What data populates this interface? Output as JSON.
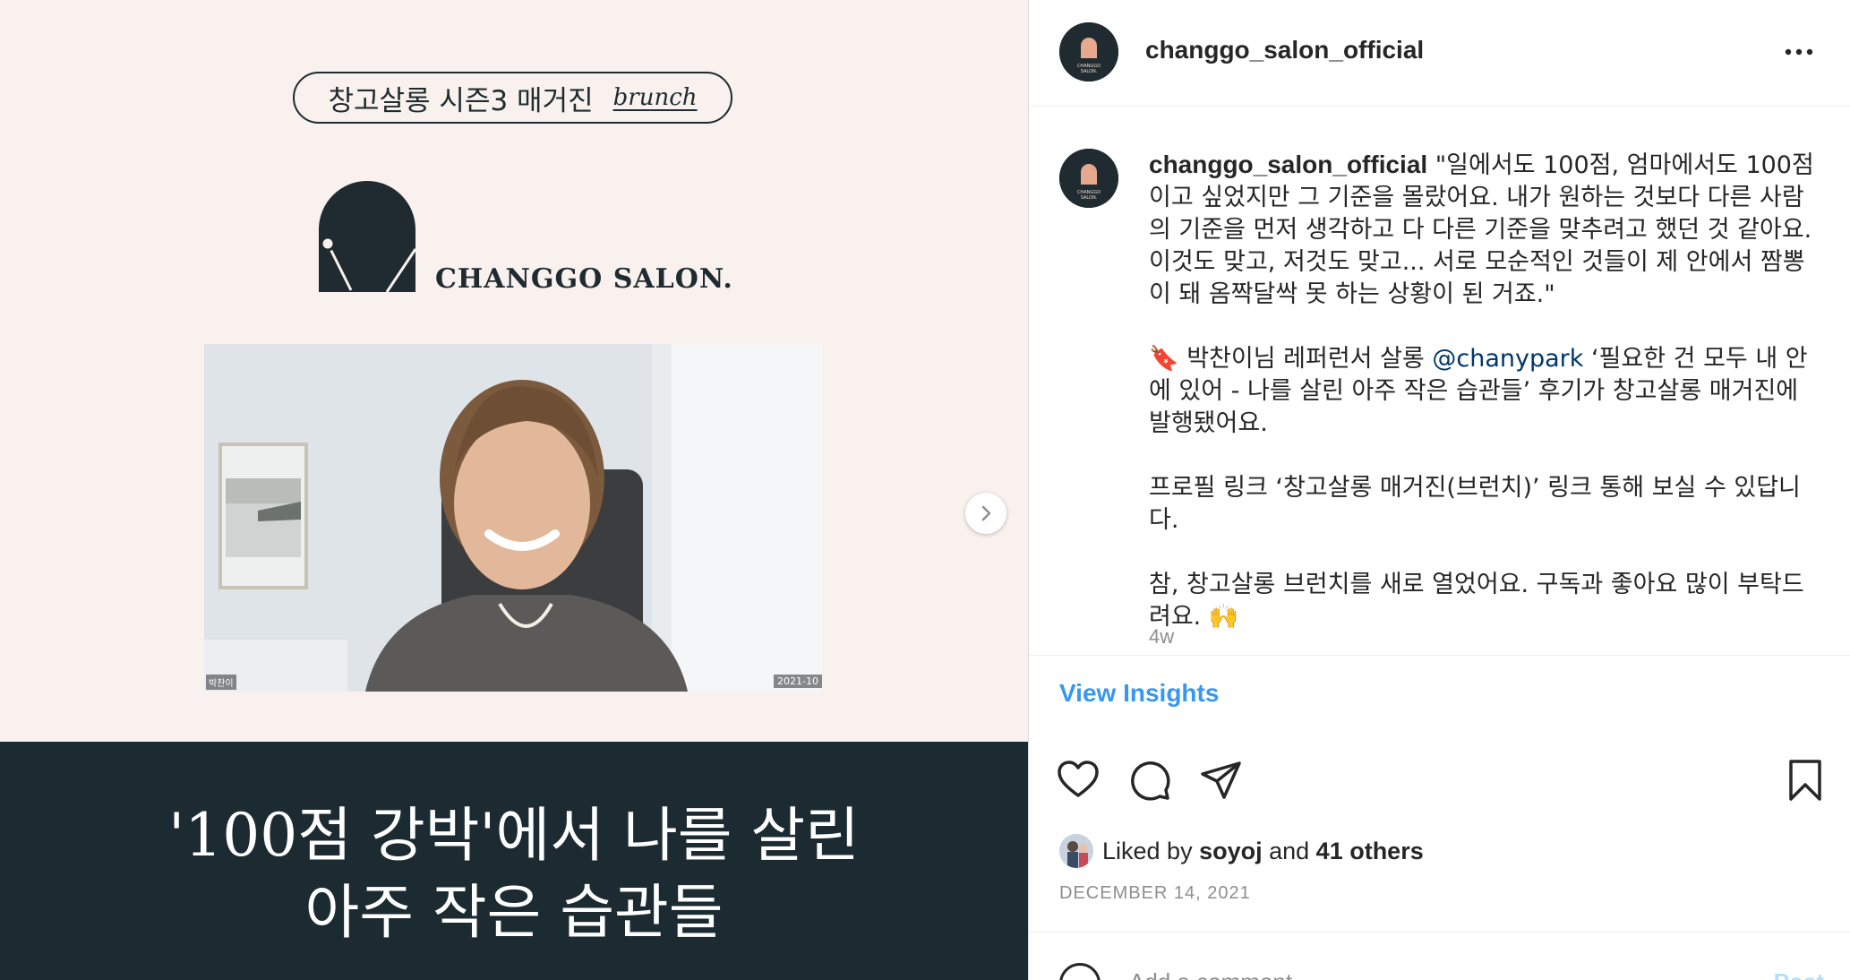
{
  "post_image": {
    "magazine_label": "창고살롱 시즌3 매거진",
    "brunch_label": "brunch",
    "logo_text": "CHANGGO SALON.",
    "video_name_tag": "박찬이",
    "video_date_tag": "2021-10",
    "headline_line1": "'100점 강박'에서 나를 살린",
    "headline_line2": "아주 작은 습관들",
    "next_arrow_icon": "chevron-right-icon"
  },
  "header": {
    "username": "changgo_salon_official",
    "more_icon": "more-horizontal-icon"
  },
  "caption": {
    "username": "changgo_salon_official",
    "paragraph1": "\"일에서도 100점, 엄마에서도 100점이고 싶었지만 그 기준을 몰랐어요. 내가 원하는 것보다 다른 사람의 기준을 먼저 생각하고 다 다른 기준을 맞추려고 했던 것 같아요. 이것도 맞고, 저것도 맞고... 서로 모순적인 것들이 제 안에서 짬뽕이 돼 옴짝달싹 못 하는 상황이 된 거죠.\"",
    "p2_emoji": "🔖",
    "p2_pre": " 박찬이님 레퍼런서 살롱 ",
    "p2_mention": "@chanypark",
    "p2_post": " ‘필요한 건 모두 내 안에 있어 - 나를 살린 아주 작은 습관들’ 후기가 창고살롱 매거진에 발행됐어요.",
    "paragraph3": "프로필 링크 ‘창고살롱 매거진(브런치)’ 링크 통해 보실 수 있답니다.",
    "paragraph4": "참, 창고살롱 브런치를 새로 열었어요. 구독과 좋아요 많이 부탁드려요. 🙌",
    "age": "4w"
  },
  "insights_label": "View Insights",
  "actions": {
    "like_icon": "heart-icon",
    "comment_icon": "comment-icon",
    "share_icon": "send-icon",
    "save_icon": "bookmark-icon"
  },
  "likes": {
    "prefix": "Liked by ",
    "user": "soyoj",
    "middle": " and ",
    "others": "41 others"
  },
  "date": "DECEMBER 14, 2021",
  "comment": {
    "placeholder": "Add a comment...",
    "post_label": "Post"
  },
  "colors": {
    "brand_dark": "#1c2b31",
    "image_background": "#f8f1ed",
    "link_blue": "#3897f0",
    "mention_blue": "#00376b",
    "muted_text": "#8e8e8e"
  }
}
